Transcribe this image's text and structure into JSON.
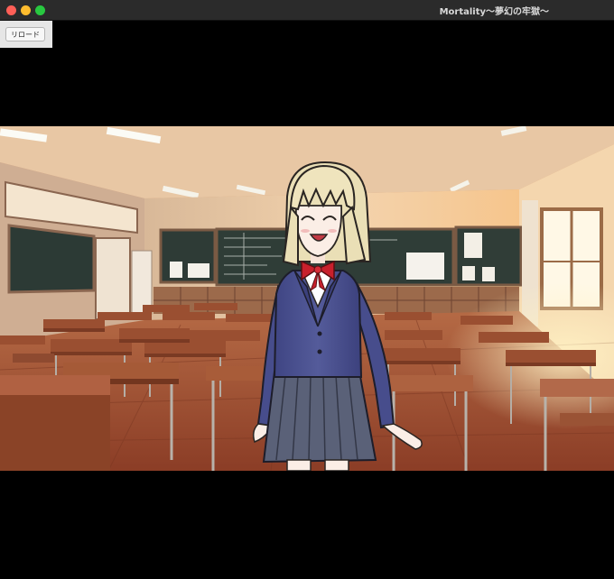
{
  "window": {
    "title": "Mortality～夢幻の牢獄～",
    "controls": [
      "close",
      "minimize",
      "zoom"
    ]
  },
  "toolbar": {
    "reload_label": "リロード"
  },
  "scene": {
    "background": "classroom",
    "character": "schoolgirl-blonde-bob-smiling",
    "colors": {
      "blazer": "#4a4f8c",
      "skirt": "#5d6479",
      "ribbon": "#c7202e",
      "hair": "#efe4bd",
      "floor": "#a65a3a",
      "wall": "#f1cfa9"
    }
  }
}
